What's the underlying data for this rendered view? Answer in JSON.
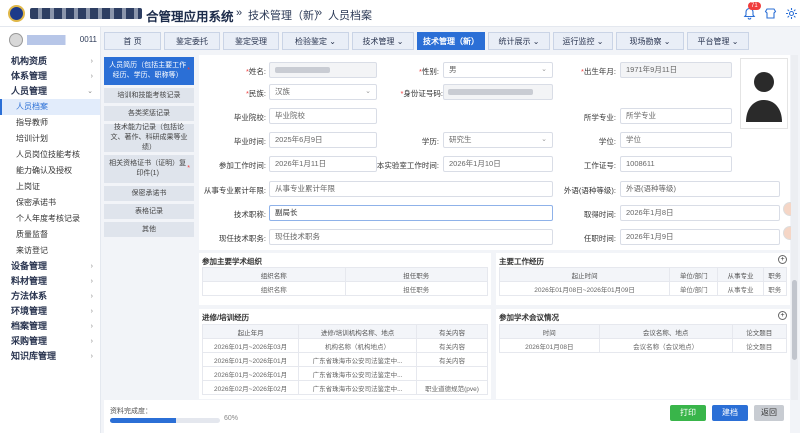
{
  "header": {
    "system_suffix": "合管理应用系统",
    "breadcrumb": [
      "技术管理（新）",
      "人员档案"
    ],
    "notifications": "71"
  },
  "sidebar": {
    "user_suffix": "0011",
    "groups": [
      {
        "label": "机构资质",
        "chev": "›",
        "items": []
      },
      {
        "label": "体系管理",
        "chev": "›",
        "items": []
      },
      {
        "label": "人员管理",
        "chev": "⌄",
        "items": [
          "人员档案",
          "指导教师",
          "培训计划",
          "人员岗位技能考核",
          "能力确认及授权",
          "上岗证",
          "保密承诺书",
          "个人年度考核记录",
          "质量监督",
          "来访登记"
        ]
      },
      {
        "label": "设备管理",
        "chev": "›",
        "items": []
      },
      {
        "label": "料材管理",
        "chev": "›",
        "items": []
      },
      {
        "label": "方法体系",
        "chev": "›",
        "items": []
      },
      {
        "label": "环境管理",
        "chev": "›",
        "items": []
      },
      {
        "label": "档案管理",
        "chev": "›",
        "items": []
      },
      {
        "label": "采购管理",
        "chev": "›",
        "items": []
      },
      {
        "label": "知识库管理",
        "chev": "›",
        "items": []
      }
    ]
  },
  "nav": {
    "tabs": [
      "首 页",
      "鉴定委托",
      "鉴定受理",
      "检验鉴定 ⌄",
      "技术管理 ⌄",
      "技术管理（新）",
      "统计展示 ⌄",
      "运行监控 ⌄",
      "现场勘察 ⌄",
      "平台管理 ⌄"
    ],
    "active_index": 5
  },
  "subtabs": [
    {
      "label": "人员简历（包括主要工作经历、学历、职称等）",
      "star": "*"
    },
    {
      "label": "培训和技能考核记录",
      "star": ""
    },
    {
      "label": "各类奖惩记录",
      "star": ""
    },
    {
      "label": "技术能力记录（包括论文、著作、科研成果等业绩）",
      "star": ""
    },
    {
      "label": "相关资格证书（证明）复印件(1)",
      "star": "*"
    },
    {
      "label": "保密承诺书",
      "star": ""
    },
    {
      "label": "表格记录",
      "star": ""
    },
    {
      "label": "其他",
      "star": ""
    }
  ],
  "form": {
    "name_label": "姓名:",
    "name_value": "",
    "gender_label": "性别:",
    "gender_value": "男",
    "birth_label": "出生年月:",
    "birth_value": "1971年9月11日",
    "ethnic_label": "民族:",
    "ethnic_value": "汉族",
    "id_label": "身份证号码:",
    "id_value": "",
    "school_label": "毕业院校:",
    "school_placeholder": "毕业院校",
    "major_label": "所学专业:",
    "major_placeholder": "所学专业",
    "grad_label": "毕业时间:",
    "grad_value": "2025年6月9日",
    "edu_label": "学历:",
    "edu_value": "研究生",
    "degree_label": "学位:",
    "degree_placeholder": "学位",
    "work_label": "参加工作时间:",
    "work_value": "2026年1月11日",
    "lab_label": "本实验室工作时间:",
    "lab_value": "2026年1月10日",
    "workno_label": "工作证号:",
    "workno_value": "1008611",
    "years_label": "从事专业累计年限:",
    "years_placeholder": "从事专业累计年限",
    "lang_label": "外语(语种等级):",
    "lang_placeholder": "外语(语种等级)",
    "title_label": "技术职称:",
    "title_value": "副局长",
    "gettime_label": "取得时间:",
    "gettime_value": "2026年1月8日",
    "post_label": "现任技术职务:",
    "post_placeholder": "现任技术职务",
    "tenure_label": "任职时间:",
    "tenure_value": "2026年1月9日"
  },
  "panels": {
    "academic": {
      "title": "参加主要学术组织",
      "cols": [
        "组织名称",
        "担任职务"
      ],
      "rows": [
        [
          "组织名称",
          "担任职务"
        ]
      ]
    },
    "experience": {
      "title": "主要工作经历",
      "cols": [
        "起止时间",
        "单位/部门",
        "从事专业",
        "职务"
      ],
      "rows": [
        [
          "2026年01月08日~2026年01月09日",
          "单位/部门",
          "从事专业",
          "职务"
        ]
      ]
    },
    "training": {
      "title": "进修/培训经历",
      "cols": [
        "起止年月",
        "进修/培训机构名称、地点",
        "有关内容"
      ],
      "rows": [
        [
          "2026年01月~2026年03月",
          "机构名称（机构地点）",
          "有关内容"
        ],
        [
          "2026年01月~2026年01月",
          "广东省珠海市公安司法鉴定中...",
          "有关内容"
        ],
        [
          "2026年01月~2026年01月",
          "广东省珠海市公安司法鉴定中...",
          ""
        ],
        [
          "2026年02月~2026年02月",
          "广东省珠海市公安司法鉴定中...",
          "职业道德规范(pve)"
        ]
      ]
    },
    "conference": {
      "title": "参加学术会议情况",
      "cols": [
        "时间",
        "会议名称、地点",
        "论文题目"
      ],
      "rows": [
        [
          "2026年01月08日",
          "会议名称（会议地点）",
          "论文题目"
        ]
      ]
    }
  },
  "footer": {
    "progress_label": "资料完成度：",
    "progress_value": 0.6,
    "progress_text": "60%",
    "print_label": "打印",
    "archive_label": "建档",
    "back_label": "返回"
  },
  "colors": {
    "accent": "#2b6fd6",
    "print": "#39b54a",
    "back": "#c8ccd2",
    "required": "#f03d3d"
  }
}
